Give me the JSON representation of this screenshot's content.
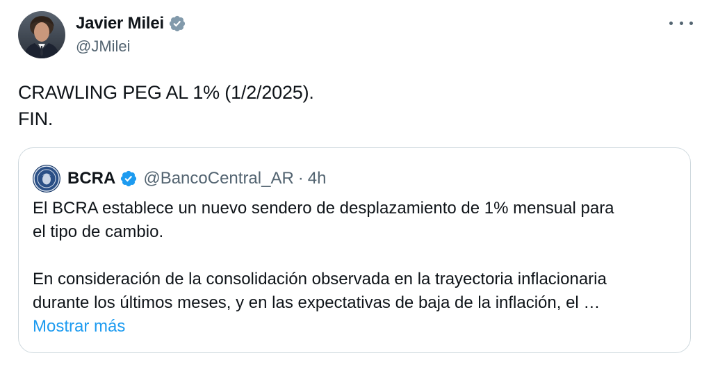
{
  "tweet": {
    "author": {
      "name": "Javier Milei",
      "handle": "@JMilei",
      "verified_color": "#829aab"
    },
    "text_lines": [
      "CRAWLING PEG AL 1% (1/2/2025).",
      "FIN."
    ],
    "more_icon": "more-horizontal-icon"
  },
  "quote": {
    "author": {
      "name": "BCRA",
      "handle": "@BancoCentral_AR",
      "separator": "·",
      "time": "4h",
      "verified_color": "#1d9bf0"
    },
    "body_lines": [
      "El BCRA establece un nuevo sendero de desplazamiento de 1% mensual para",
      "el tipo de cambio.",
      "En consideración de la consolidación observada en la trayectoria inflacionaria",
      "durante los últimos meses, y en las expectativas de baja de la inflación, el …"
    ],
    "show_more_label": "Mostrar más"
  }
}
